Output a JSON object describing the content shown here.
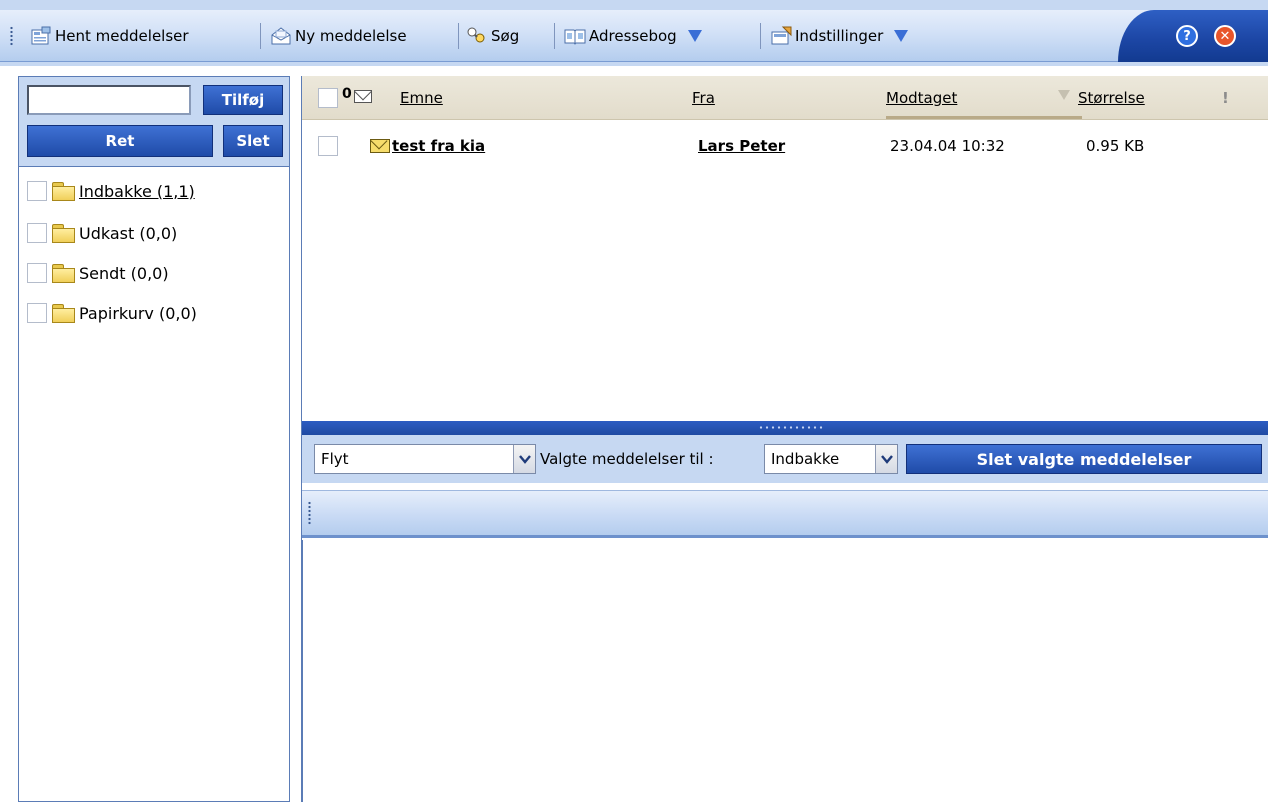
{
  "toolbar": {
    "get_messages_label": "Hent meddelelser",
    "new_message_label": "Ny meddelelse",
    "search_label": "Søg",
    "address_book_label": "Adressebog",
    "settings_label": "Indstillinger",
    "help_symbol": "?",
    "close_symbol": "✕"
  },
  "folders": {
    "add_label": "Tilføj",
    "edit_label": "Ret",
    "delete_label": "Slet",
    "new_folder_value": "",
    "items": [
      {
        "name": "Indbakke (1,1)",
        "open": true,
        "active": true
      },
      {
        "name": "Udkast (0,0)",
        "open": false,
        "active": false
      },
      {
        "name": "Sendt (0,0)",
        "open": false,
        "active": false
      },
      {
        "name": "Papirkurv (0,0)",
        "open": false,
        "active": false
      }
    ]
  },
  "message_list": {
    "columns": {
      "attachment_symbol": "0",
      "subject": "Emne",
      "from": "Fra",
      "received": "Modtaget",
      "size": "Størrelse",
      "priority_symbol": "!"
    },
    "sorted_by": "Modtaget",
    "rows": [
      {
        "subject": "test fra kia",
        "from": "Lars Peter",
        "received": "23.04.04 10:32",
        "size": "0.95 KB",
        "unread": true
      }
    ]
  },
  "actions": {
    "operation_value": "Flyt",
    "middle_text": "Valgte meddelelser til :",
    "target_folder_value": "Indbakke",
    "delete_selected_label": "Slet valgte meddelelser"
  },
  "colors": {
    "accent": "#1f4ba8",
    "toolbar_bg": "#c6d8f2",
    "header_bg": "#ece8db"
  }
}
